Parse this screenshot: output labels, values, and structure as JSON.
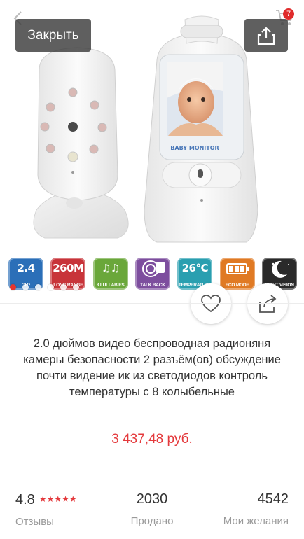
{
  "header": {
    "close_label": "Закрыть",
    "cart_count": "7",
    "icons": [
      "back-chevron-icon",
      "cart-icon",
      "share-icon"
    ]
  },
  "gallery": {
    "screen_label": "BABY MONITOR",
    "features": [
      {
        "big": "2.4",
        "small": "GHz",
        "color": "#2b6fb8"
      },
      {
        "big": "260M",
        "small": "LONG RANGE",
        "color": "#c8343a"
      },
      {
        "big": "♫♫",
        "small": "8 LULLABIES",
        "color": "#6aa73a"
      },
      {
        "big": "",
        "small": "TALK BACK",
        "color": "#7d4e9e"
      },
      {
        "big": "26°C",
        "small": "TEMPERATURE",
        "color": "#2a9fb0"
      },
      {
        "big": "",
        "small": "ECO MODE",
        "color": "#e07a24"
      },
      {
        "big": "",
        "small": "NIGHT VISION",
        "color": "#2a2a2a"
      }
    ],
    "slide_count": 6,
    "active_slide": 1
  },
  "product": {
    "title": "2.0 дюймов видео беспроводная радионяня камеры безопасности 2 разъём(ов) обсуждение почти видение ик из светодиодов контроль температуры с 8 колыбельные",
    "price": "3 437,48 руб."
  },
  "stats": {
    "rating": "4.8",
    "stars": "★★★★★",
    "reviews_label": "Отзывы",
    "sold": "2030",
    "sold_label": "Продано",
    "wishes": "4542",
    "wishes_label": "Мои желания"
  },
  "colors": {
    "accent": "#e4393c",
    "overlay": "#3c3c3c"
  }
}
